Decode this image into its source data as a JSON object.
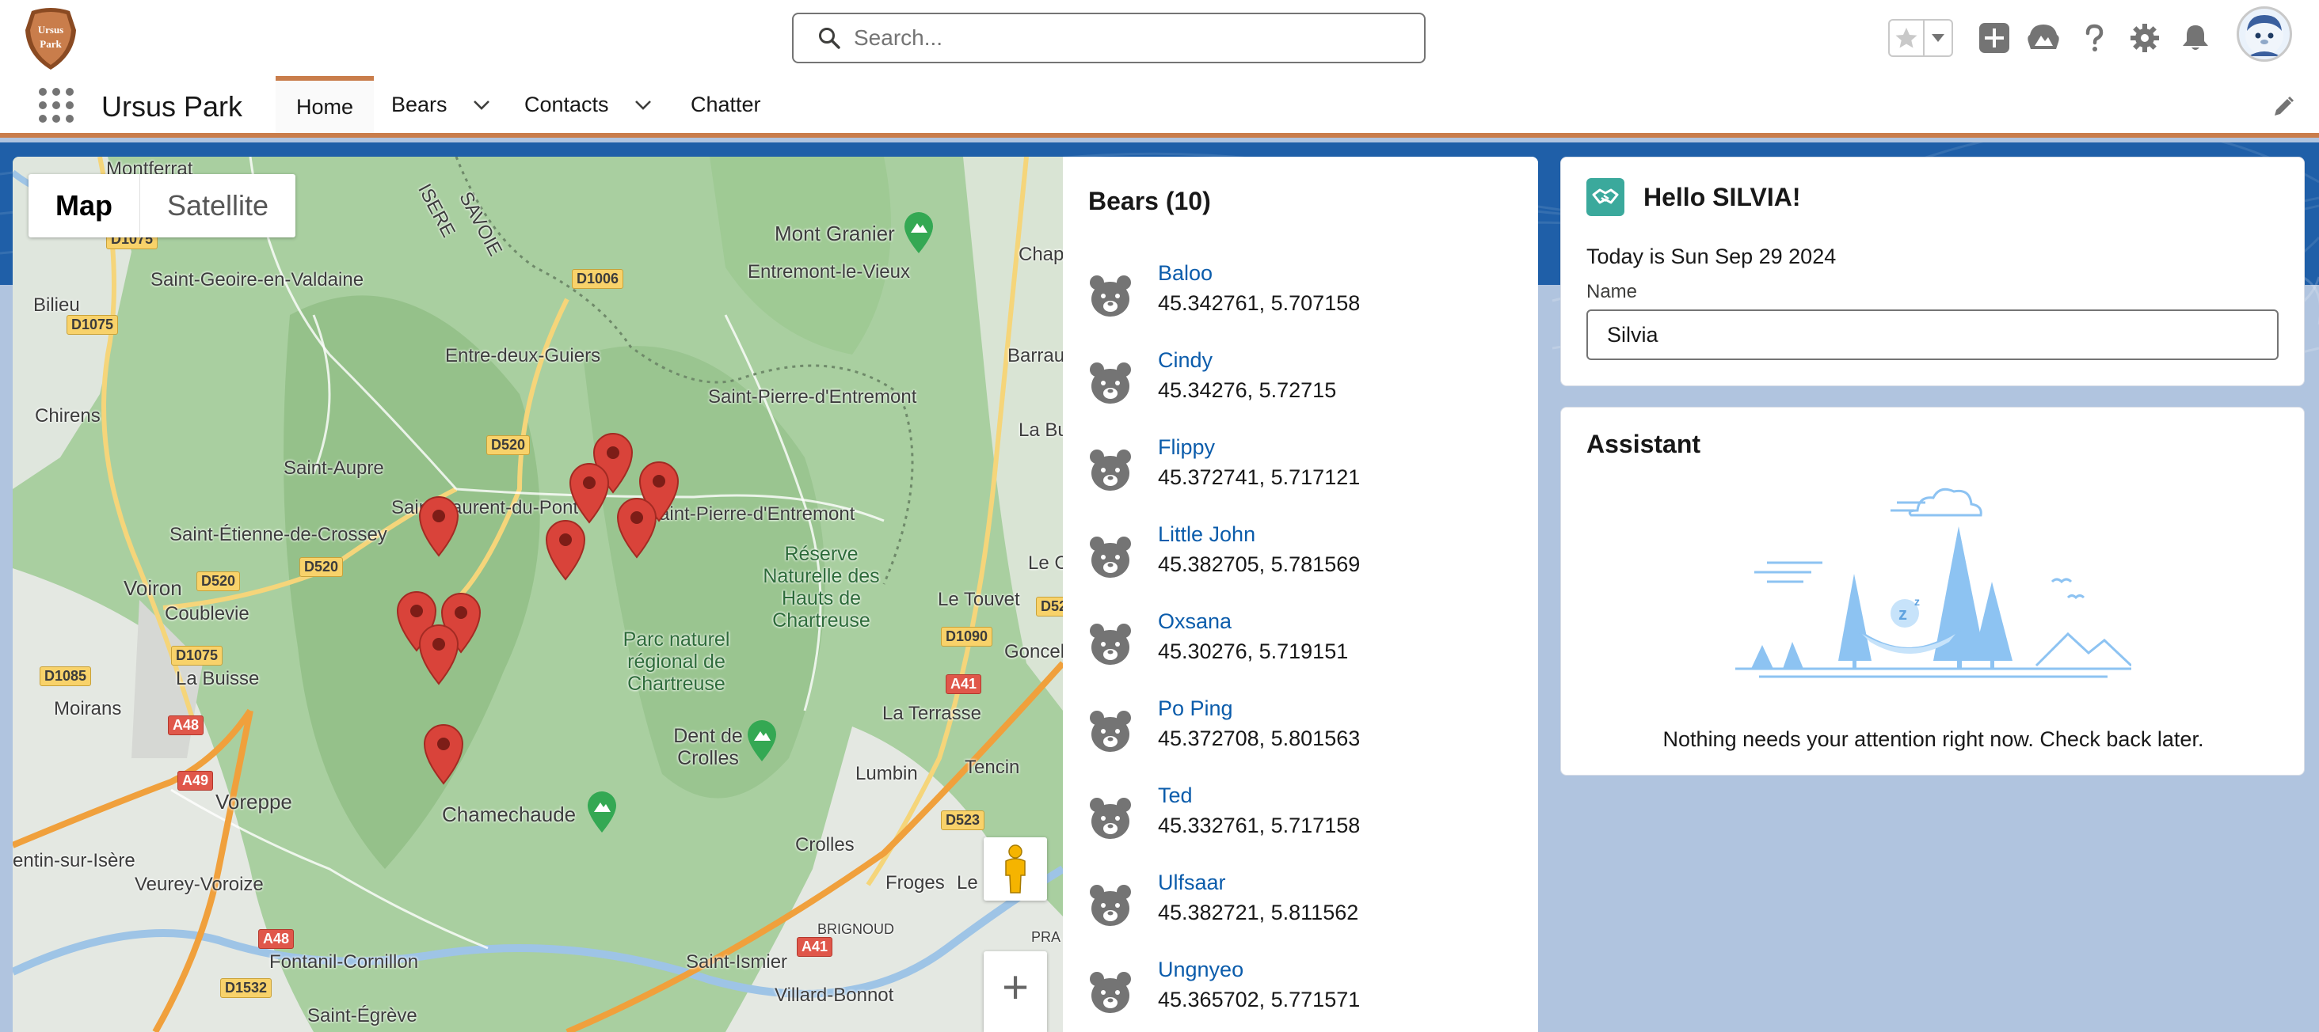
{
  "header": {
    "logo_text": "Ursus Park",
    "search": {
      "placeholder": "Search...",
      "value": ""
    },
    "icons": [
      "star-icon",
      "chevron-down-icon",
      "plus-icon",
      "trailhead-icon",
      "help-icon",
      "gear-icon",
      "bell-icon",
      "avatar"
    ]
  },
  "nav": {
    "app_name": "Ursus Park",
    "items": [
      {
        "label": "Home",
        "active": true,
        "has_menu": false
      },
      {
        "label": "Bears",
        "active": false,
        "has_menu": true
      },
      {
        "label": "Contacts",
        "active": false,
        "has_menu": true
      },
      {
        "label": "Chatter",
        "active": false,
        "has_menu": false
      }
    ]
  },
  "map": {
    "type_controls": {
      "map": "Map",
      "satellite": "Satellite",
      "selected": "Map"
    },
    "labels": {
      "montferrat": "Montferrat",
      "savoie": "SAVOIE",
      "isere": "ISERE",
      "mont_granier": "Mont Granier",
      "chap": "Chap",
      "saint_geoire": "Saint-Geoire-en-Valdaine",
      "entremont_le_vieux": "Entremont-le-Vieux",
      "bilieu": "Bilieu",
      "entre_deux_guiers": "Entre-deux-Guiers",
      "barrau": "Barrau",
      "chirens": "Chirens",
      "saint_pierre_entremont_top": "Saint-Pierre-d'Entremont",
      "la_bu": "La Bu",
      "saint_aupre": "Saint-Aupre",
      "saint_laurent_du_pont": "Saint-Laurent-du-Pont",
      "saint_pierre_entremont_mid": "Saint-Pierre-d'Entremont",
      "saint_etienne": "Saint-Étienne-de-Crossey",
      "reserve": "Réserve Naturelle des Hauts de Chartreuse",
      "voiron": "Voiron",
      "coublevie": "Coublevie",
      "le_touvet": "Le Touvet",
      "le_c": "Le C",
      "parc": "Parc naturel régional de Chartreuse",
      "goncel": "Goncel",
      "la_buisse": "La Buisse",
      "moirans": "Moirans",
      "la_terrasse": "La Terrasse",
      "dent_de_crolles": "Dent de Crolles",
      "lumbin": "Lumbin",
      "tencin": "Tencin",
      "voreppe": "Voreppe",
      "chamechaude": "Chamechaude",
      "saint_martin": "entin-sur-Isère",
      "crolles": "Crolles",
      "veurey": "Veurey-Voroize",
      "froges": "Froges",
      "le_v": "Le",
      "brignoud": "BRIGNOUD",
      "pra": "PRA",
      "fontanil": "Fontanil-Cornillon",
      "saint_ismier": "Saint-Ismier",
      "villard_bonnot": "Villard-Bonnot",
      "saint_egreve": "Saint-Égrève"
    },
    "roads": {
      "d1075_a": "D1075",
      "d1075_b": "D1075",
      "d1006": "D1006",
      "d520_a": "D520",
      "d520_b": "D520",
      "d520_c": "D520",
      "d1075_c": "D1075",
      "d1085": "D1085",
      "d1090": "D1090",
      "d52": "D52",
      "a48_a": "A48",
      "a41_a": "A41",
      "a49": "A49",
      "d523": "D523",
      "a41_b": "A41",
      "a48_b": "A48",
      "d1532": "D1532"
    },
    "zoom_in_label": "+"
  },
  "bears": {
    "title": "Bears (10)",
    "items": [
      {
        "name": "Baloo",
        "coords": "45.342761, 5.707158"
      },
      {
        "name": "Cindy",
        "coords": "45.34276, 5.72715"
      },
      {
        "name": "Flippy",
        "coords": "45.372741, 5.717121"
      },
      {
        "name": "Little John",
        "coords": "45.382705, 5.781569"
      },
      {
        "name": "Oxsana",
        "coords": "45.30276, 5.719151"
      },
      {
        "name": "Po Ping",
        "coords": "45.372708, 5.801563"
      },
      {
        "name": "Ted",
        "coords": "45.332761, 5.717158"
      },
      {
        "name": "Ulfsaar",
        "coords": "45.382721, 5.811562"
      },
      {
        "name": "Ungnyeo",
        "coords": "45.365702, 5.771571"
      }
    ]
  },
  "hello": {
    "title": "Hello SILVIA!",
    "today": "Today is Sun Sep 29 2024",
    "name_label": "Name",
    "name_value": "Silvia"
  },
  "assistant": {
    "title": "Assistant",
    "message": "Nothing needs your attention right now. Check back later."
  },
  "colors": {
    "brand_accent": "#c97d4b",
    "link": "#0b5cab",
    "marker": "#d9433a",
    "hello_icon": "#3ba99c",
    "page_bg": "#b0c4df"
  }
}
